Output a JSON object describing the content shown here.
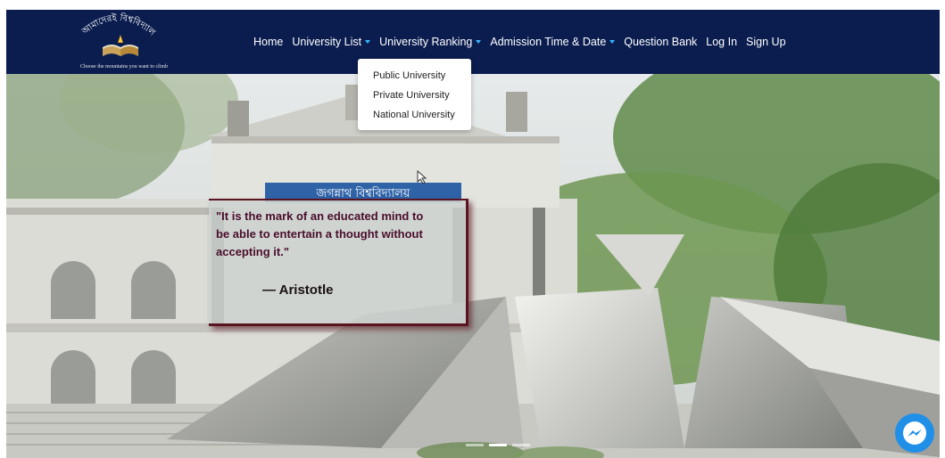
{
  "brand": {
    "logo_text": "আমাদেরই বিশ্ববিদ্যালয়",
    "tagline": "Choose the mountains you want to climb"
  },
  "nav": {
    "items": [
      {
        "label": "Home",
        "has_caret": false
      },
      {
        "label": "University List",
        "has_caret": true
      },
      {
        "label": "University Ranking",
        "has_caret": true
      },
      {
        "label": "Admission Time & Date",
        "has_caret": true
      },
      {
        "label": "Question Bank",
        "has_caret": false
      },
      {
        "label": "Log In",
        "has_caret": false
      },
      {
        "label": "Sign Up",
        "has_caret": false
      }
    ],
    "dropdown": [
      "Public University",
      "Private University",
      "National University"
    ]
  },
  "hero": {
    "building_sign": "জগন্নাথ বিশ্ববিদ্যালয়",
    "quote": "\"It is the mark of an educated mind to be able to entertain a thought without accepting it.\"",
    "author": "— Aristotle"
  },
  "colors": {
    "navbar": "#0b1d4f",
    "caret": "#37b6ff",
    "quote_text": "#4a0d2b",
    "quote_border": "#5a1420",
    "messenger": "#1f8fe8"
  },
  "icons": {
    "messenger": "messenger-icon",
    "caret": "chevron-down-icon"
  }
}
